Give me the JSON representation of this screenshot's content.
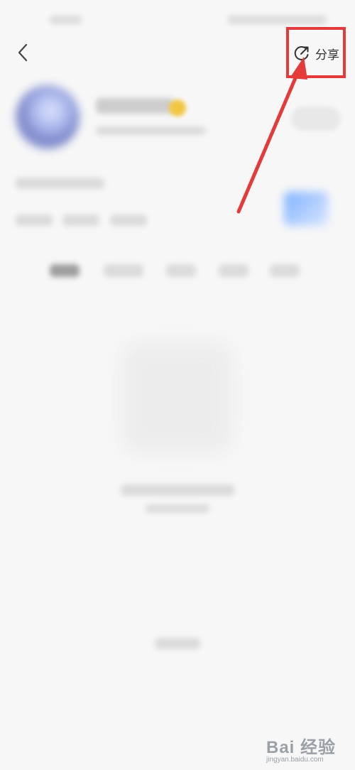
{
  "header": {
    "back_icon": "chevron-left-icon",
    "share_icon": "share-refresh-icon",
    "share_label": "分享"
  },
  "annotation": {
    "highlight_color": "#e33a3a",
    "arrow_color": "#e33a3a"
  },
  "watermark": {
    "logo_text": "Bai  经验",
    "site_text": "jingyan.baidu.com"
  }
}
